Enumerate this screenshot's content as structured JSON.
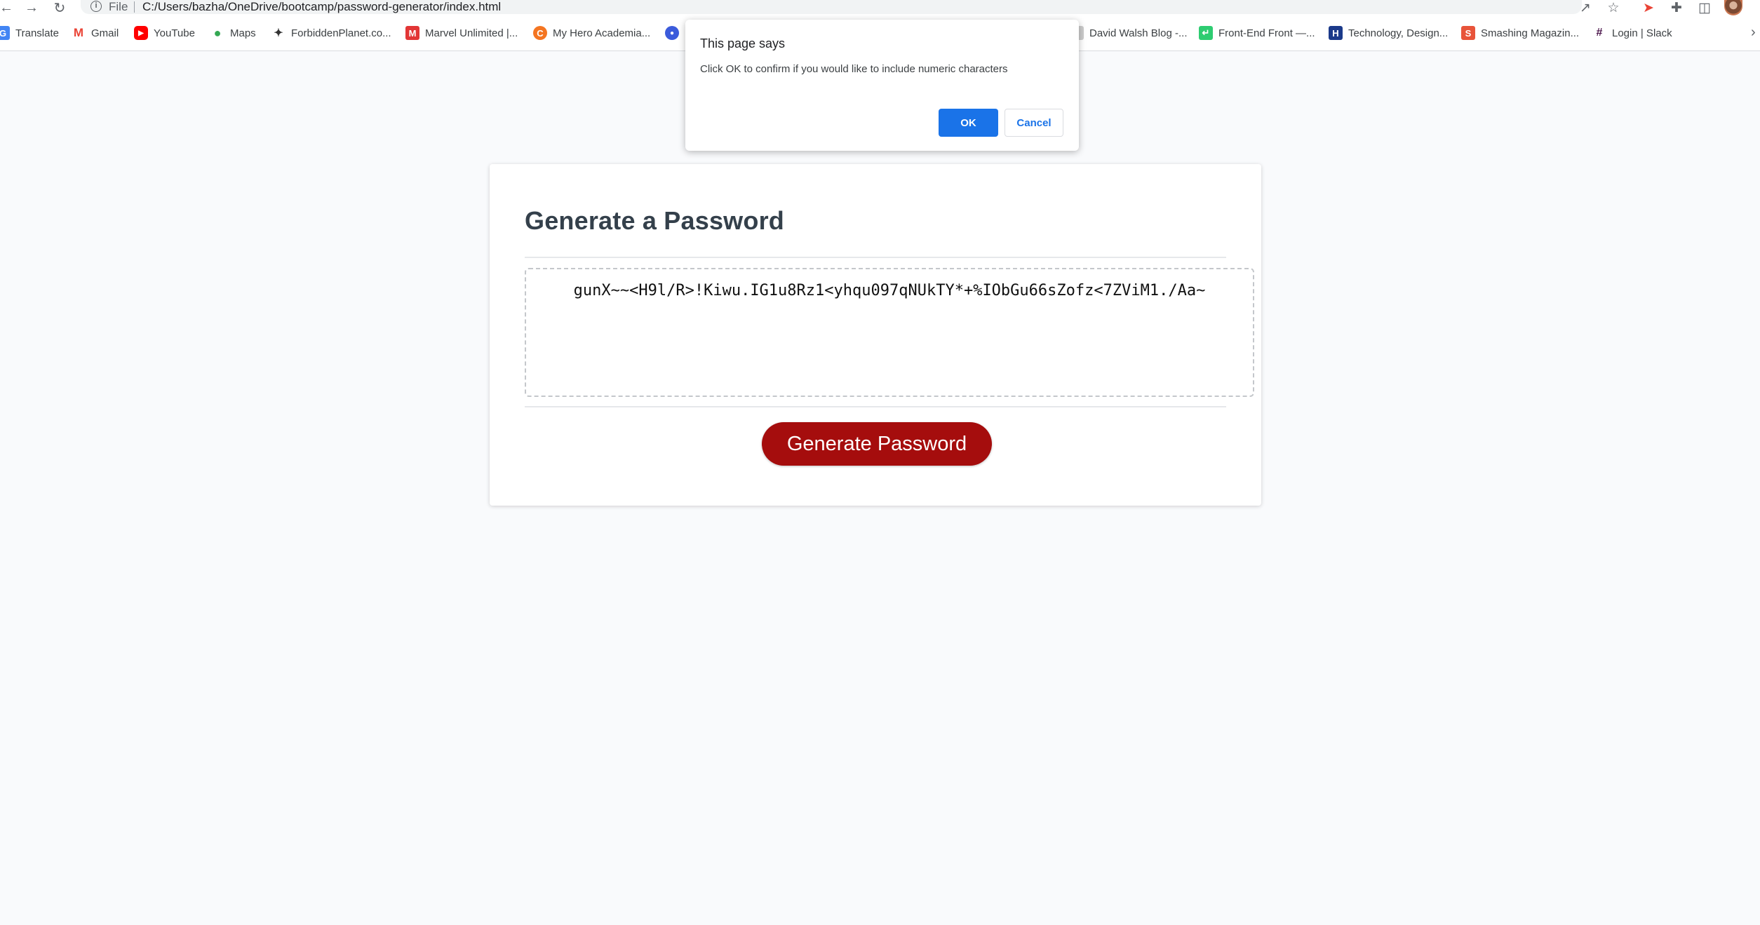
{
  "browser": {
    "scheme_label": "File",
    "url": "C:/Users/bazha/OneDrive/bootcamp/password-generator/index.html"
  },
  "icons": {
    "back": "arrow-left-icon",
    "forward": "arrow-right-icon",
    "reload": "reload-icon",
    "info": "info-icon",
    "share": "share-icon",
    "star": "star-icon",
    "extension_red": "extension-icon",
    "puzzle": "puzzle-icon",
    "sidepanel": "side-panel-icon",
    "more": "chevron-right-icon"
  },
  "bookmarks": [
    {
      "label": "Translate",
      "icon": "translate-icon",
      "color": "#4285f4"
    },
    {
      "label": "Gmail",
      "icon": "gmail-icon",
      "color": "#ea4335"
    },
    {
      "label": "YouTube",
      "icon": "youtube-icon",
      "color": "#ff0000"
    },
    {
      "label": "Maps",
      "icon": "maps-pin-icon",
      "color": "#34a853"
    },
    {
      "label": "ForbiddenPlanet.co...",
      "icon": "forbidden-planet-icon",
      "color": "#333333"
    },
    {
      "label": "Marvel Unlimited |...",
      "icon": "marvel-icon",
      "color": "#e23636"
    },
    {
      "label": "My Hero Academia...",
      "icon": "crunchyroll-icon",
      "color": "#f47521"
    },
    {
      "label": "",
      "icon": "blue-circle-icon",
      "color": "#3b5bdb"
    },
    {
      "label": "David Walsh Blog -...",
      "icon": "david-walsh-icon",
      "color": "#888888"
    },
    {
      "label": "Front-End Front —...",
      "icon": "front-end-front-icon",
      "color": "#2ecc71"
    },
    {
      "label": "Technology, Design...",
      "icon": "h-icon",
      "color": "#1b3a8a"
    },
    {
      "label": "Smashing Magazin...",
      "icon": "smashing-icon",
      "color": "#e8543a"
    },
    {
      "label": "Login | Slack",
      "icon": "slack-icon",
      "color": "#4a154b"
    }
  ],
  "page": {
    "title": "Generate a Password",
    "password": "gunX~~<H9l/R>!Kiwu.IG1u8Rz1<yhqu097qNUkTY*+%IObGu66sZofz<7ZViM1./Aa~",
    "generate_label": "Generate Password",
    "accent": "#a50d0d"
  },
  "dialog": {
    "title": "This page says",
    "message": "Click OK to confirm if you would like to include numeric characters",
    "ok_label": "OK",
    "cancel_label": "Cancel",
    "primary_color": "#1a73e8"
  }
}
